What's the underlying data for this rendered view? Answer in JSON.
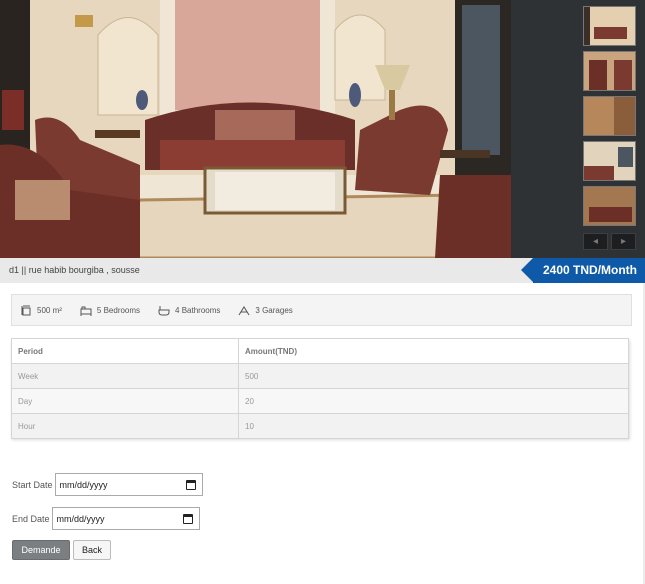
{
  "listing": {
    "address": "d1 || rue habib bourgiba , sousse",
    "price": "2400 TND/Month"
  },
  "gallery": {
    "main_image": "living-room-photo",
    "thumbnail_count": 5,
    "prev_icon": "chevron-left-icon",
    "next_icon": "chevron-right-icon"
  },
  "features": {
    "area": "500 m²",
    "bedrooms": "5 Bedrooms",
    "bathrooms": "4 Bathrooms",
    "garages": "3 Garages"
  },
  "rates": {
    "headers": [
      "Period",
      "Amount(TND)"
    ],
    "rows": [
      [
        "Week",
        "500"
      ],
      [
        "Day",
        "20"
      ],
      [
        "Hour",
        "10"
      ]
    ]
  },
  "form": {
    "start_label": "Start Date",
    "end_label": "End Date",
    "date_placeholder": "mm/dd/yyyy"
  },
  "buttons": {
    "demande": "Demande",
    "back": "Back"
  },
  "colors": {
    "price_badge": "#0f5aa8",
    "gallery_bg": "#2f3235"
  }
}
